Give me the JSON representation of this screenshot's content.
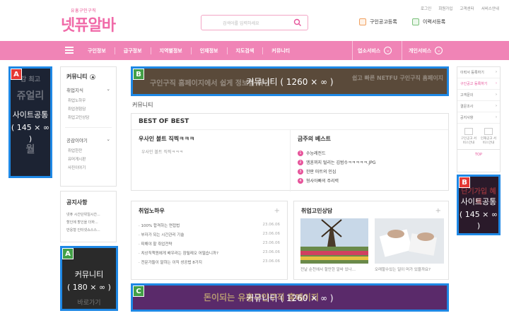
{
  "header": {
    "logo_small": "유흥구인구직",
    "logo_main": "넷퓨알바",
    "search_placeholder": "검색어를 입력하세요",
    "toplinks": [
      "로그인",
      "회원가입",
      "고객센터",
      "서비스안내"
    ],
    "btn_job_post": "구인공고등록",
    "btn_resume": "이력서등록"
  },
  "nav": {
    "items": [
      "구인정보",
      "급구정보",
      "지역별정보",
      "인재정보",
      "지도검색",
      "커뮤니티"
    ],
    "business": "업소서비스",
    "personal": "개인서비스"
  },
  "ads": {
    "A_left": {
      "tag": "A",
      "label": "사이트공통",
      "size": "( 145 × ∞ )",
      "bg": [
        "감 최고",
        "쥬얼리",
        "월"
      ]
    },
    "A_bottom": {
      "tag": "A",
      "label": "커뮤니티",
      "size": "( 180 × ∞ )",
      "bg": "바로가기"
    },
    "B_top": {
      "tag": "B",
      "label": "커뮤니티",
      "size": "( 1260 × ∞ )",
      "bg_left": "구인구직 홈페이지에서 쉽게 정보를 확인",
      "bg_right": "쉽고 빠른 NETFU 구인구직 홈페이지"
    },
    "B_right": {
      "tag": "B",
      "label": "사이트공통",
      "size": "( 145 × ∞ )",
      "bg": "단기가입 혜택"
    },
    "C_bottom": {
      "tag": "C",
      "label": "커뮤니티",
      "size": "( 1260 × ∞ )",
      "bg": "돈이되는 유흥구인구직 홈페이지"
    }
  },
  "sidebar": {
    "title": "커뮤니티",
    "group1": "취업지식",
    "group1_links": [
      "취업노하우",
      "취업경험담",
      "취업고민상담"
    ],
    "group2": "공감이야기",
    "group2_links": [
      "취업한잔",
      "유머게시판",
      "사진이야기"
    ]
  },
  "notice": {
    "title": "공지사항",
    "items": [
      "넷퓨 시간단위일시간...",
      "할인에 할인을 더하...",
      "반응형 인터넷쇼스스..."
    ]
  },
  "main": {
    "crumb": "커뮤니티",
    "best_title": "BEST OF BEST",
    "best_left_title": "우사인 볼트 직찍ㅋㅋㅋ",
    "best_left_item": "우사인 볼트 직찍ㅋㅋㅋ",
    "best_right_title": "금주의 베스트",
    "best_right_items": [
      "수능레전드",
      "엠훈꺼지 털리는 김범수ㅋㅋㅋㅋㅋ.JPG",
      "한판 마트의 인심",
      "형사아빠의 주리력"
    ],
    "knowhow_title": "취업노하우",
    "knowhow_rows": [
      {
        "t": "100% 합격하는 면접법",
        "d": "23.06.06"
      },
      {
        "t": "부자가 되는 시간관리 기술",
        "d": "23.06.06"
      },
      {
        "t": "피해야 할 취업전략",
        "d": "23.06.06"
      },
      {
        "t": "치상직책원에게 배우라는 잠릴레오 어떨습니까?",
        "d": "23.06.06"
      },
      {
        "t": "전문가들이 말하는 이직 성공법 8가지",
        "d": "23.06.06"
      }
    ],
    "counsel_title": "취업고민상담",
    "counsel_caps": [
      "전날 순천에서 할만한 알바 있나...",
      "오래할수있는 일이 머가 있을까요?"
    ]
  },
  "right": {
    "links": [
      "이력서 등록하기",
      "구인공고 등록하기",
      "고객문의",
      "결문조사",
      "공지사항"
    ],
    "svc1": "구인공고 서비스안내",
    "svc2": "인재공고 서비스안내",
    "top": "TOP"
  },
  "colors": {
    "nav": "#f084b6",
    "accent": "#e6539a",
    "ad_border": "#1e88e5"
  }
}
